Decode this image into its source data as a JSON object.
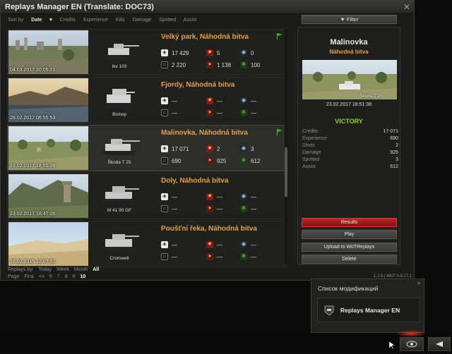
{
  "window": {
    "title": "Replays Manager EN (Translate: DOC73)"
  },
  "sortbar": {
    "label": "Sort by",
    "items": [
      "Date",
      "Credits",
      "Experience",
      "Kills",
      "Damage",
      "Spotted",
      "Assist"
    ],
    "active": "Date"
  },
  "replays": [
    {
      "date": "04.03.2017 20:05:21",
      "tank": "Ikv 103",
      "map": "Velký park, Náhodná bitva",
      "flag": true,
      "dmg": "17 429",
      "xp": "2 220",
      "kills": "5",
      "assist": "1 138",
      "spotted": "0",
      "credits": "100"
    },
    {
      "date": "26.02.2017 06:55:53",
      "tank": "Bishop",
      "map": "Fjordy, Náhodná bitva",
      "flag": false,
      "dmg": "—",
      "xp": "—",
      "kills": "—",
      "assist": "—",
      "spotted": "—",
      "credits": "—"
    },
    {
      "date": "23.02.2017 18:51:38",
      "tank": "Škoda T 25",
      "map": "Malinovka, Náhodná bitva",
      "flag": true,
      "dmg": "17 071",
      "xp": "690",
      "kills": "2",
      "assist": "925",
      "spotted": "3",
      "credits": "612"
    },
    {
      "date": "23.02.2017 18:47:06",
      "tank": "M 41 90 GF",
      "map": "Doly, Náhodná bitva",
      "flag": false,
      "dmg": "—",
      "xp": "—",
      "kills": "—",
      "assist": "—",
      "spotted": "—",
      "credits": "—"
    },
    {
      "date": "17.02.2015 12:07:50",
      "tank": "Cromwell",
      "map": "Poušťní řeka, Náhodná bitva",
      "flag": false,
      "dmg": "—",
      "xp": "—",
      "kills": "—",
      "assist": "—",
      "spotted": "—",
      "credits": "—"
    }
  ],
  "footer": {
    "replays_by_label": "Replays by:",
    "periods": [
      "Today",
      "Week",
      "Month",
      "All"
    ],
    "active_period": "All",
    "page_label": "Page",
    "pages": [
      "First",
      "<<",
      "6",
      "7",
      "8",
      "9",
      "10"
    ],
    "active_page": "10",
    "right_text": "1 2 5 | WoT 0.9.17.1"
  },
  "filter": {
    "label": "Filter"
  },
  "detail": {
    "map": "Malinovka",
    "mode": "Náhodná bitva",
    "tank": "Škoda T 25",
    "date": "23.02.2017 18:51:38",
    "result": "VICTORY",
    "stats": [
      {
        "label": "Credits",
        "value": "17 071"
      },
      {
        "label": "Experience",
        "value": "690"
      },
      {
        "label": "Shots",
        "value": "2"
      },
      {
        "label": "Damage",
        "value": "925"
      },
      {
        "label": "Spotted",
        "value": "3"
      },
      {
        "label": "Assist",
        "value": "612"
      }
    ]
  },
  "actions": {
    "results": "Results",
    "play": "Play",
    "upload": "Upload to WoTReplays",
    "delete": "Delete"
  },
  "mods_popup": {
    "title": "Список модификаций",
    "item": "Replays Manager EN"
  },
  "colors": {
    "accent_orange": "#e0a146",
    "victory_green": "#8ed235",
    "results_red": "#c12525"
  }
}
